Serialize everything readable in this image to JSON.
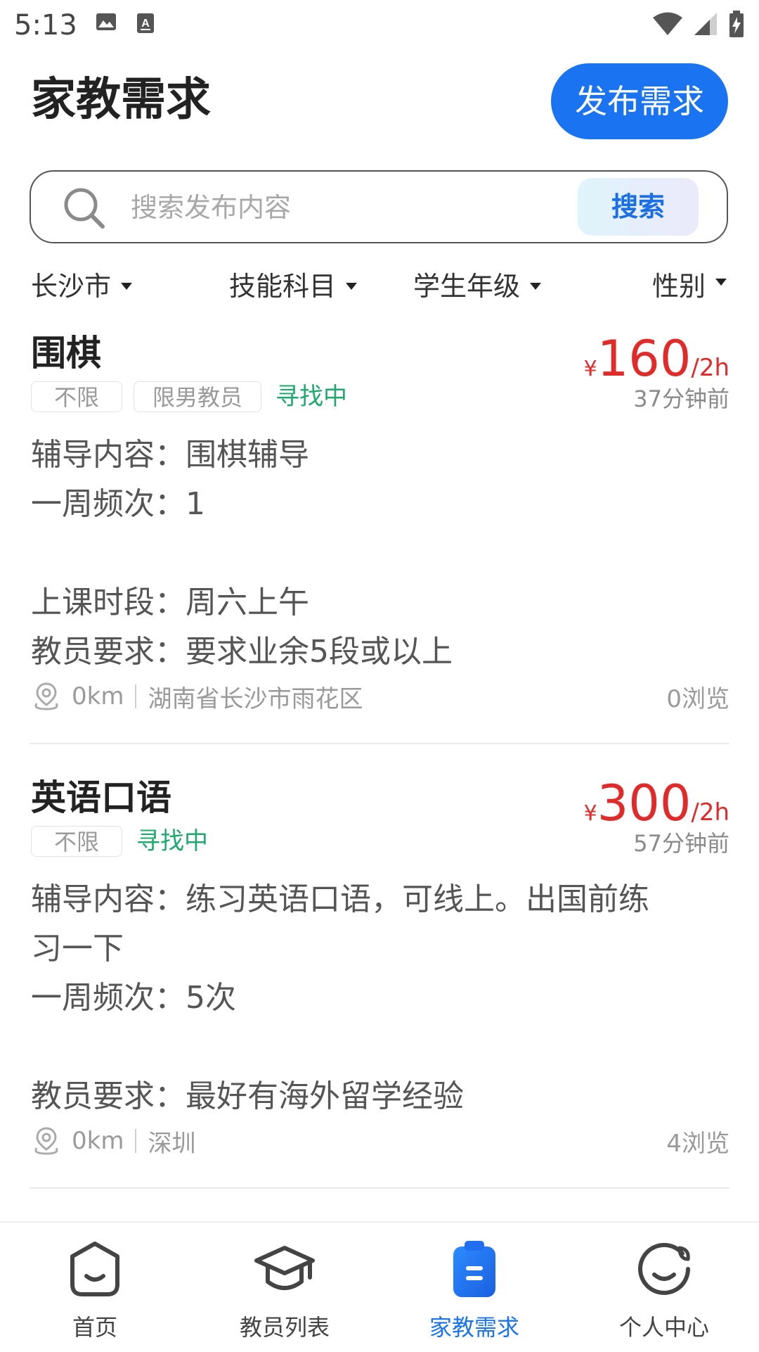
{
  "status_bar": {
    "time": "5:13",
    "left_icons": [
      "image-icon",
      "keyboard-icon"
    ],
    "right_icons": [
      "wifi-icon",
      "signal-icon",
      "battery-charging-icon"
    ]
  },
  "header": {
    "title": "家教需求",
    "publish_label": "发布需求"
  },
  "search": {
    "placeholder": "搜索发布内容",
    "button_label": "搜索"
  },
  "filters": [
    {
      "label": "长沙市"
    },
    {
      "label": "技能科目"
    },
    {
      "label": "学生年级"
    },
    {
      "label": "性别"
    }
  ],
  "listings": [
    {
      "title": "围棋",
      "price_currency": "¥",
      "price_amount": "160",
      "price_unit": "/2h",
      "posted": "37分钟前",
      "tags": [
        "不限",
        "限男教员"
      ],
      "status": "寻找中",
      "details": [
        "辅导内容：围棋辅导",
        "一周频次：1",
        "",
        "上课时段：周六上午",
        "教员要求：要求业余5段或以上"
      ],
      "distance": "0km",
      "location": "湖南省长沙市雨花区",
      "views": "0浏览"
    },
    {
      "title": "英语口语",
      "price_currency": "¥",
      "price_amount": "300",
      "price_unit": "/2h",
      "posted": "57分钟前",
      "tags": [
        "不限"
      ],
      "status": "寻找中",
      "details": [
        "辅导内容：练习英语口语，可线上。出国前练",
        "习一下",
        "一周频次：5次",
        "",
        "教员要求：最好有海外留学经验"
      ],
      "distance": "0km",
      "location": "深圳",
      "views": "4浏览"
    }
  ],
  "tab_bar": {
    "active_color": "#1a73f0",
    "tabs": [
      {
        "label": "首页",
        "icon": "home-icon"
      },
      {
        "label": "教员列表",
        "icon": "graduation-cap-icon"
      },
      {
        "label": "家教需求",
        "icon": "clipboard-icon"
      },
      {
        "label": "个人中心",
        "icon": "profile-icon"
      }
    ]
  }
}
